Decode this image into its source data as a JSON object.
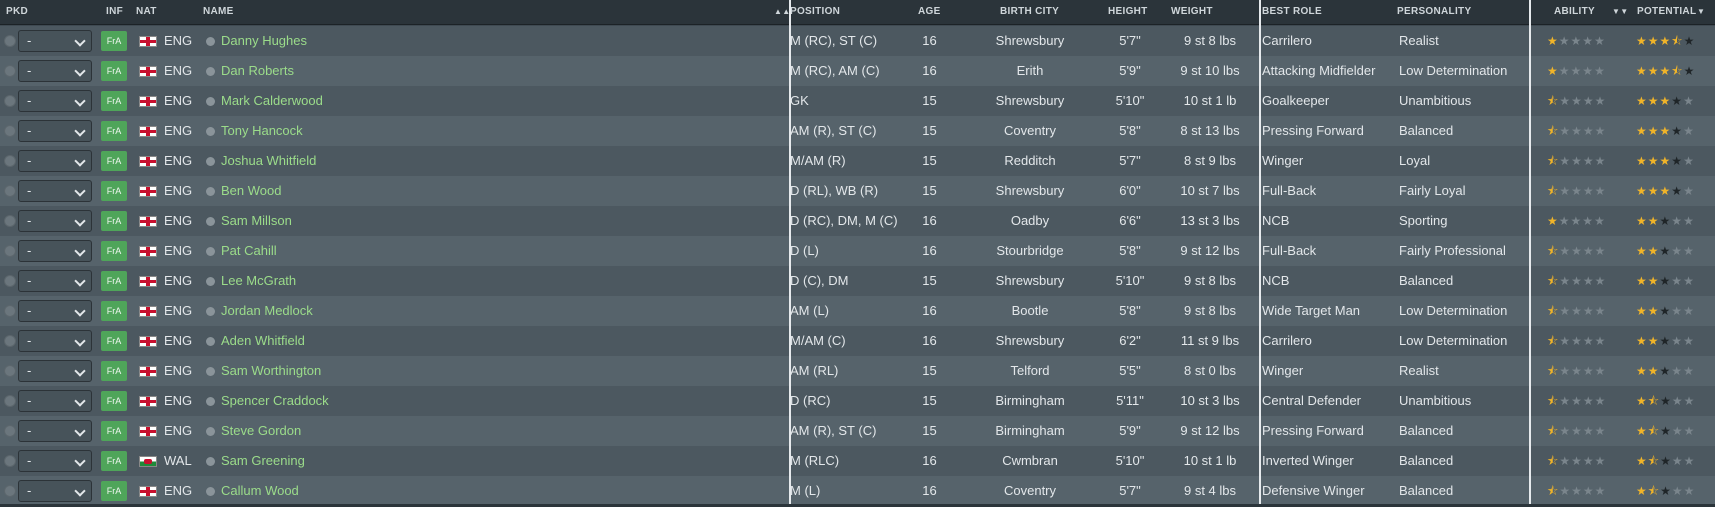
{
  "headers": {
    "pkd": "PKD",
    "inf": "INF",
    "nat": "NAT",
    "name": "NAME",
    "position": "POSITION",
    "age": "AGE",
    "birth_city": "BIRTH CITY",
    "height": "HEIGHT",
    "weight": "WEIGHT",
    "best_role": "BEST ROLE",
    "personality": "PERSONALITY",
    "ability": "ABILITY",
    "potential": "POTENTIAL",
    "name_sort_icon": "sort-arrows-icon",
    "ability_sort_icon": "sort-down-icon",
    "potential_sort_icon": "sort-down-icon"
  },
  "colors": {
    "name_text": "#9bdc8a",
    "star_full": "#f0b429",
    "inf_badge": "#4fa55a"
  },
  "players": [
    {
      "pkd": "-",
      "inf": "FrA",
      "nat": "ENG",
      "flag": "england-flag-icon",
      "name": "Danny Hughes",
      "position": "M (RC), ST (C)",
      "age": "16",
      "birth_city": "Shrewsbury",
      "height": "5'7\"",
      "weight": "9 st 8 lbs",
      "best_role": "Carrilero",
      "personality": "Realist",
      "ability_stars": 1,
      "potential_stars": 3.5
    },
    {
      "pkd": "-",
      "inf": "FrA",
      "nat": "ENG",
      "flag": "england-flag-icon",
      "name": "Dan Roberts",
      "position": "M (RC), AM (C)",
      "age": "16",
      "birth_city": "Erith",
      "height": "5'9\"",
      "weight": "9 st 10 lbs",
      "best_role": "Attacking Midfielder",
      "personality": "Low Determination",
      "ability_stars": 1,
      "potential_stars": 3.5
    },
    {
      "pkd": "-",
      "inf": "FrA",
      "nat": "ENG",
      "flag": "england-flag-icon",
      "name": "Mark Calderwood",
      "position": "GK",
      "age": "15",
      "birth_city": "Shrewsbury",
      "height": "5'10\"",
      "weight": "10 st 1 lb",
      "best_role": "Goalkeeper",
      "personality": "Unambitious",
      "ability_stars": 0.5,
      "potential_stars": 3
    },
    {
      "pkd": "-",
      "inf": "FrA",
      "nat": "ENG",
      "flag": "england-flag-icon",
      "name": "Tony Hancock",
      "position": "AM (R), ST (C)",
      "age": "15",
      "birth_city": "Coventry",
      "height": "5'8\"",
      "weight": "8 st 13 lbs",
      "best_role": "Pressing Forward",
      "personality": "Balanced",
      "ability_stars": 0.5,
      "potential_stars": 3
    },
    {
      "pkd": "-",
      "inf": "FrA",
      "nat": "ENG",
      "flag": "england-flag-icon",
      "name": "Joshua Whitfield",
      "position": "M/AM (R)",
      "age": "15",
      "birth_city": "Redditch",
      "height": "5'7\"",
      "weight": "8 st 9 lbs",
      "best_role": "Winger",
      "personality": "Loyal",
      "ability_stars": 0.5,
      "potential_stars": 3
    },
    {
      "pkd": "-",
      "inf": "FrA",
      "nat": "ENG",
      "flag": "england-flag-icon",
      "name": "Ben Wood",
      "position": "D (RL), WB (R)",
      "age": "15",
      "birth_city": "Shrewsbury",
      "height": "6'0\"",
      "weight": "10 st 7 lbs",
      "best_role": "Full-Back",
      "personality": "Fairly Loyal",
      "ability_stars": 0.5,
      "potential_stars": 3
    },
    {
      "pkd": "-",
      "inf": "FrA",
      "nat": "ENG",
      "flag": "england-flag-icon",
      "name": "Sam Millson",
      "position": "D (RC), DM, M (C)",
      "age": "16",
      "birth_city": "Oadby",
      "height": "6'6\"",
      "weight": "13 st 3 lbs",
      "best_role": "NCB",
      "personality": "Sporting",
      "ability_stars": 1,
      "potential_stars": 2
    },
    {
      "pkd": "-",
      "inf": "FrA",
      "nat": "ENG",
      "flag": "england-flag-icon",
      "name": "Pat Cahill",
      "position": "D (L)",
      "age": "16",
      "birth_city": "Stourbridge",
      "height": "5'8\"",
      "weight": "9 st 12 lbs",
      "best_role": "Full-Back",
      "personality": "Fairly Professional",
      "ability_stars": 0.5,
      "potential_stars": 2
    },
    {
      "pkd": "-",
      "inf": "FrA",
      "nat": "ENG",
      "flag": "england-flag-icon",
      "name": "Lee McGrath",
      "position": "D (C), DM",
      "age": "15",
      "birth_city": "Shrewsbury",
      "height": "5'10\"",
      "weight": "9 st 8 lbs",
      "best_role": "NCB",
      "personality": "Balanced",
      "ability_stars": 0.5,
      "potential_stars": 2
    },
    {
      "pkd": "-",
      "inf": "FrA",
      "nat": "ENG",
      "flag": "england-flag-icon",
      "name": "Jordan Medlock",
      "position": "AM (L)",
      "age": "16",
      "birth_city": "Bootle",
      "height": "5'8\"",
      "weight": "9 st 8 lbs",
      "best_role": "Wide Target Man",
      "personality": "Low Determination",
      "ability_stars": 0.5,
      "potential_stars": 2
    },
    {
      "pkd": "-",
      "inf": "FrA",
      "nat": "ENG",
      "flag": "england-flag-icon",
      "name": "Aden Whitfield",
      "position": "M/AM (C)",
      "age": "16",
      "birth_city": "Shrewsbury",
      "height": "6'2\"",
      "weight": "11 st 9 lbs",
      "best_role": "Carrilero",
      "personality": "Low Determination",
      "ability_stars": 0.5,
      "potential_stars": 2
    },
    {
      "pkd": "-",
      "inf": "FrA",
      "nat": "ENG",
      "flag": "england-flag-icon",
      "name": "Sam Worthington",
      "position": "AM (RL)",
      "age": "15",
      "birth_city": "Telford",
      "height": "5'5\"",
      "weight": "8 st 0 lbs",
      "best_role": "Winger",
      "personality": "Realist",
      "ability_stars": 0.5,
      "potential_stars": 2
    },
    {
      "pkd": "-",
      "inf": "FrA",
      "nat": "ENG",
      "flag": "england-flag-icon",
      "name": "Spencer Craddock",
      "position": "D (RC)",
      "age": "15",
      "birth_city": "Birmingham",
      "height": "5'11\"",
      "weight": "10 st 3 lbs",
      "best_role": "Central Defender",
      "personality": "Unambitious",
      "ability_stars": 0.5,
      "potential_stars": 1.5
    },
    {
      "pkd": "-",
      "inf": "FrA",
      "nat": "ENG",
      "flag": "england-flag-icon",
      "name": "Steve Gordon",
      "position": "AM (R), ST (C)",
      "age": "15",
      "birth_city": "Birmingham",
      "height": "5'9\"",
      "weight": "9 st 12 lbs",
      "best_role": "Pressing Forward",
      "personality": "Balanced",
      "ability_stars": 0.5,
      "potential_stars": 1.5
    },
    {
      "pkd": "-",
      "inf": "FrA",
      "nat": "WAL",
      "flag": "wales-flag-icon",
      "name": "Sam Greening",
      "position": "M (RLC)",
      "age": "16",
      "birth_city": "Cwmbran",
      "height": "5'10\"",
      "weight": "10 st 1 lb",
      "best_role": "Inverted Winger",
      "personality": "Balanced",
      "ability_stars": 0.5,
      "potential_stars": 1.5
    },
    {
      "pkd": "-",
      "inf": "FrA",
      "nat": "ENG",
      "flag": "england-flag-icon",
      "name": "Callum Wood",
      "position": "M (L)",
      "age": "16",
      "birth_city": "Coventry",
      "height": "5'7\"",
      "weight": "9 st 4 lbs",
      "best_role": "Defensive Winger",
      "personality": "Balanced",
      "ability_stars": 0.5,
      "potential_stars": 1.5
    }
  ]
}
